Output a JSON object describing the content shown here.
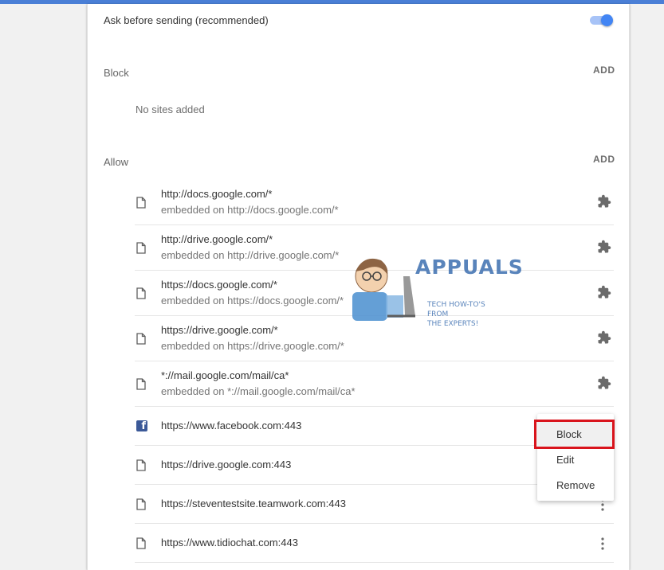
{
  "ask": {
    "label": "Ask before sending (recommended)",
    "enabled": true
  },
  "block": {
    "title": "Block",
    "add_label": "ADD",
    "empty_text": "No sites added"
  },
  "allow": {
    "title": "Allow",
    "add_label": "ADD"
  },
  "sites": [
    {
      "url": "http://docs.google.com/*",
      "embedded": "embedded on http://docs.google.com/*",
      "icon": "file-icon",
      "action_icon": "puzzle-icon"
    },
    {
      "url": "http://drive.google.com/*",
      "embedded": "embedded on http://drive.google.com/*",
      "icon": "file-icon",
      "action_icon": "puzzle-icon"
    },
    {
      "url": "https://docs.google.com/*",
      "embedded": "embedded on https://docs.google.com/*",
      "icon": "file-icon",
      "action_icon": "puzzle-icon"
    },
    {
      "url": "https://drive.google.com/*",
      "embedded": "embedded on https://drive.google.com/*",
      "icon": "file-icon",
      "action_icon": "puzzle-icon"
    },
    {
      "url": "*://mail.google.com/mail/ca*",
      "embedded": "embedded on *://mail.google.com/mail/ca*",
      "icon": "file-icon",
      "action_icon": "puzzle-icon"
    },
    {
      "url": "https://www.facebook.com:443",
      "icon": "facebook-icon",
      "action_icon": "more-vert-icon"
    },
    {
      "url": "https://drive.google.com:443",
      "icon": "file-icon",
      "action_icon": "more-vert-icon"
    },
    {
      "url": "https://steventestsite.teamwork.com:443",
      "icon": "file-icon",
      "action_icon": "more-vert-icon"
    },
    {
      "url": "https://www.tidiochat.com:443",
      "icon": "file-icon",
      "action_icon": "more-vert-icon"
    }
  ],
  "context_menu": {
    "items": [
      "Block",
      "Edit",
      "Remove"
    ],
    "highlighted": "Block",
    "highlight_color": "#d9141c"
  },
  "watermark": {
    "brand": "APPUALS",
    "tagline_1": "TECH HOW-TO'S FROM",
    "tagline_2": "THE EXPERTS!"
  },
  "colors": {
    "accent": "#4285f4",
    "top_bar": "#4a7fd6",
    "facebook": "#3b5998"
  }
}
